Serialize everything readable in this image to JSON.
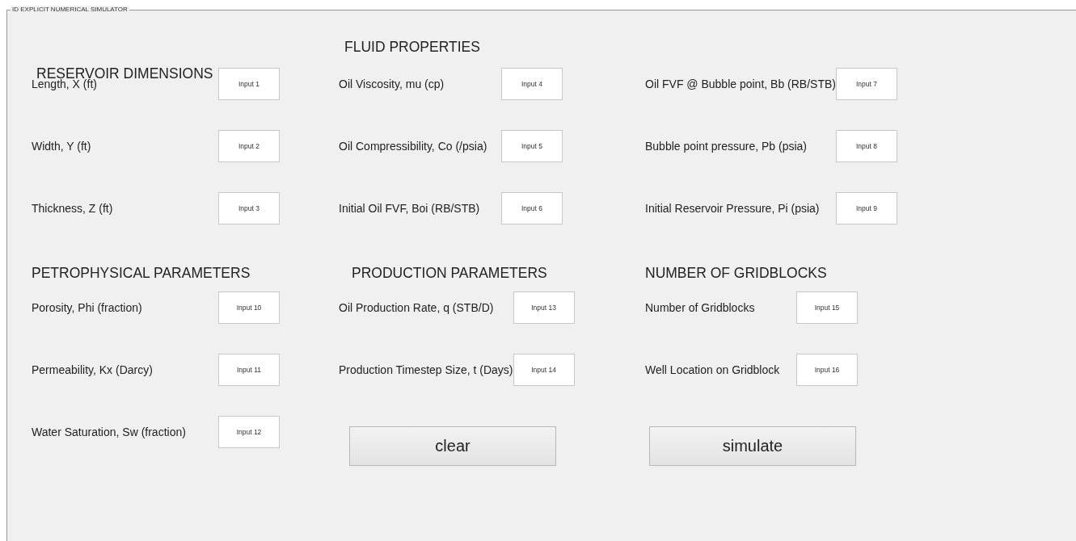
{
  "panel": {
    "title": "ID EXPLICIT NUMERICAL SIMULATOR"
  },
  "blocks": [
    {
      "sections": [
        {
          "heading": "RESERVOIR DIMENSIONS",
          "items": [
            {
              "kind": "field",
              "label": "Length, X (ft)",
              "value": "Input 1"
            },
            {
              "kind": "field",
              "label": "Width, Y (ft)",
              "value": "Input 2"
            },
            {
              "kind": "field",
              "label": "Thickness, Z (ft)",
              "value": "Input 3"
            }
          ]
        },
        {
          "heading": "FLUID PROPERTIES",
          "items": [
            {
              "kind": "field",
              "label": "Oil Viscosity, mu (cp)",
              "value": "Input 4"
            },
            {
              "kind": "field",
              "label": "Oil Compressibility, Co (/psia)",
              "value": "Input 5"
            },
            {
              "kind": "field",
              "label": "Initial Oil FVF, Boi (RB/STB)",
              "value": "Input 6"
            }
          ]
        },
        {
          "items": [
            {
              "kind": "field",
              "label": "Oil FVF @ Bubble point, Bb (RB/STB)",
              "value": "Input 7"
            },
            {
              "kind": "field",
              "label": "Bubble point pressure, Pb (psia)",
              "value": "Input 8"
            },
            {
              "kind": "field",
              "label": "Initial Reservoir Pressure, Pi (psia)",
              "value": "Input 9"
            }
          ]
        }
      ]
    },
    {
      "sections": [
        {
          "heading": "PETROPHYSICAL PARAMETERS",
          "items": [
            {
              "kind": "field",
              "label": "Porosity, Phi (fraction)",
              "value": "Input 10"
            },
            {
              "kind": "field",
              "label": "Permeability, Kx (Darcy)",
              "value": "Input 11"
            },
            {
              "kind": "field",
              "label": "Water Saturation, Sw (fraction)",
              "value": "Input 12"
            }
          ]
        },
        {
          "heading": "PRODUCTION  PARAMETERS",
          "items": [
            {
              "kind": "field",
              "label": "Oil Production Rate, q (STB/D)",
              "value": "Input 13"
            },
            {
              "kind": "field",
              "label": "Production Timestep Size, t (Days)",
              "value": "Input 14"
            },
            {
              "kind": "button",
              "label": "clear"
            }
          ]
        },
        {
          "heading": "NUMBER OF GRIDBLOCKS",
          "items": [
            {
              "kind": "field",
              "label": "Number of Gridblocks",
              "value": "Input 15"
            },
            {
              "kind": "field",
              "label": "Well Location on Gridblock",
              "value": "Input 16"
            },
            {
              "kind": "button",
              "label": "simulate"
            }
          ]
        }
      ]
    }
  ]
}
